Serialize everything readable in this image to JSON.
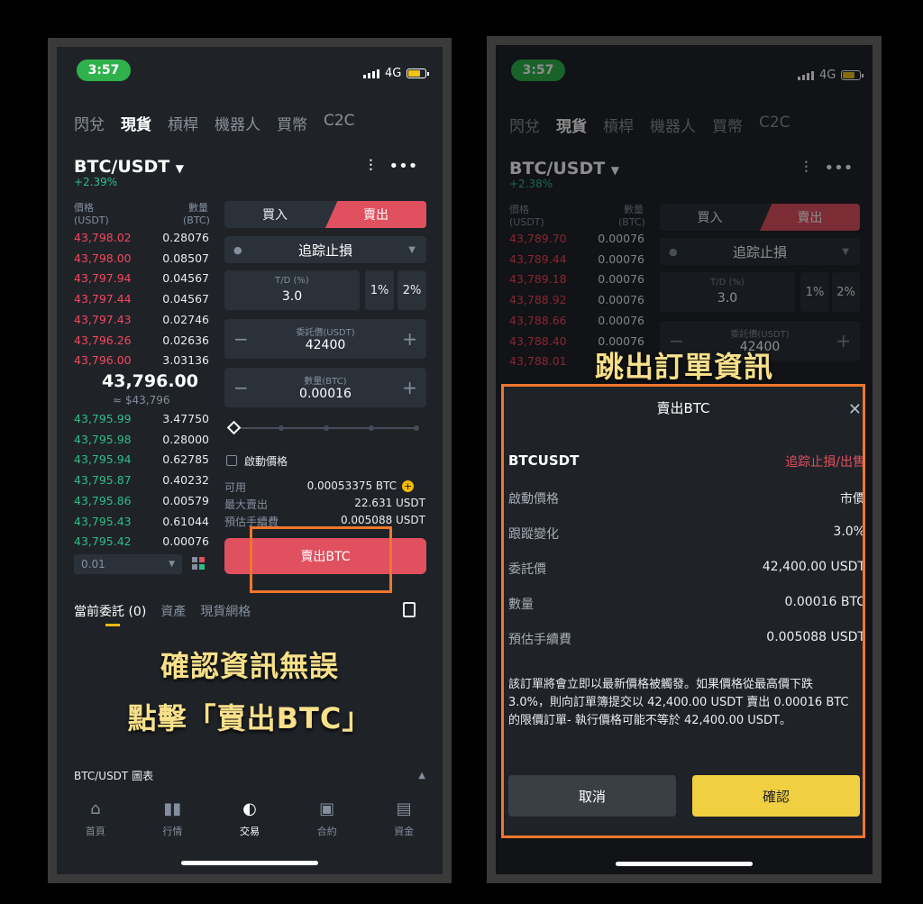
{
  "left": {
    "time": "3:57",
    "network": "4G",
    "nav": [
      "閃兌",
      "現貨",
      "槓桿",
      "機器人",
      "買幣",
      "C2C"
    ],
    "pair": "BTC/USDT",
    "change": "+2.39%",
    "ob_head_price": "價格",
    "ob_head_price_unit": "(USDT)",
    "ob_head_qty": "數量",
    "ob_head_qty_unit": "(BTC)",
    "asks": [
      {
        "p": "43,798.02",
        "q": "0.28076"
      },
      {
        "p": "43,798.00",
        "q": "0.08507"
      },
      {
        "p": "43,797.94",
        "q": "0.04567"
      },
      {
        "p": "43,797.44",
        "q": "0.04567"
      },
      {
        "p": "43,797.43",
        "q": "0.02746"
      },
      {
        "p": "43,796.26",
        "q": "0.02636"
      },
      {
        "p": "43,796.00",
        "q": "3.03136"
      }
    ],
    "mid_price": "43,796.00",
    "mid_usd": "≈ $43,796",
    "bids": [
      {
        "p": "43,795.99",
        "q": "3.47750"
      },
      {
        "p": "43,795.98",
        "q": "0.28000"
      },
      {
        "p": "43,795.94",
        "q": "0.62785"
      },
      {
        "p": "43,795.87",
        "q": "0.40232"
      },
      {
        "p": "43,795.86",
        "q": "0.00579"
      },
      {
        "p": "43,795.43",
        "q": "0.61044"
      },
      {
        "p": "43,795.42",
        "q": "0.00076"
      }
    ],
    "depth": "0.01",
    "buy_label": "買入",
    "sell_label": "賣出",
    "order_type": "追踪止損",
    "td_label": "T/D (%)",
    "td_value": "3.0",
    "pct1": "1%",
    "pct2": "2%",
    "price_label": "委託價(USDT)",
    "price_value": "42400",
    "qty_label": "數量(BTC)",
    "qty_value": "0.00016",
    "activate_label": "啟動價格",
    "avail_label": "可用",
    "avail_value": "0.00053375 BTC",
    "max_label": "最大賣出",
    "max_value": "22.631 USDT",
    "fee_label": "預估手續費",
    "fee_value": "0.005088 USDT",
    "sell_btn": "賣出BTC",
    "tabs": [
      "當前委託 (0)",
      "資產",
      "現貨網格"
    ],
    "caption1": "確認資訊無誤",
    "caption2": "點擊「賣出BTC」",
    "chart_label": "BTC/USDT 圖表",
    "bottom_nav": [
      "首頁",
      "行情",
      "交易",
      "合約",
      "資金"
    ]
  },
  "right": {
    "time": "3:57",
    "network": "4G",
    "nav": [
      "閃兌",
      "現貨",
      "槓桿",
      "機器人",
      "買幣",
      "C2C"
    ],
    "pair": "BTC/USDT",
    "change": "+2.38%",
    "ob_head_price": "價格",
    "ob_head_price_unit": "(USDT)",
    "ob_head_qty": "數量",
    "ob_head_qty_unit": "(BTC)",
    "asks": [
      {
        "p": "43,789.70",
        "q": "0.00076"
      },
      {
        "p": "43,789.44",
        "q": "0.00076"
      },
      {
        "p": "43,789.18",
        "q": "0.00076"
      },
      {
        "p": "43,788.92",
        "q": "0.00076"
      },
      {
        "p": "43,788.66",
        "q": "0.00076"
      },
      {
        "p": "43,788.40",
        "q": "0.00076"
      },
      {
        "p": "43,788.01",
        "q": ""
      }
    ],
    "buy_label": "買入",
    "sell_label": "賣出",
    "order_type": "追踪止損",
    "td_label": "T/D (%)",
    "td_value": "3.0",
    "pct1": "1%",
    "pct2": "2%",
    "price_label": "委託價(USDT)",
    "price_value": "42400",
    "caption": "跳出訂單資訊",
    "sheet": {
      "title": "賣出BTC",
      "symbol": "BTCUSDT",
      "type": "追踪止損/出售",
      "rows": [
        {
          "k": "啟動價格",
          "v": "市價"
        },
        {
          "k": "跟蹤變化",
          "v": "3.0%"
        },
        {
          "k": "委託價",
          "v": "42,400.00 USDT"
        },
        {
          "k": "數量",
          "v": "0.00016 BTC"
        },
        {
          "k": "預估手續費",
          "v": "0.005088 USDT"
        }
      ],
      "desc": "該訂單將會立即以最新價格被觸發。如果價格從最高價下跌 3.0%，則向訂單簿提交以 42,400.00 USDT 賣出 0.00016 BTC 的限價訂單- 執行價格可能不等於 42,400.00 USDT。",
      "cancel": "取消",
      "confirm": "確認"
    }
  },
  "colors": {
    "red": "#e0505f",
    "green": "#2ebd85",
    "yellow_button": "#f0cf40",
    "highlight_orange": "#f0762e",
    "caption_yellow": "#f7e08a"
  }
}
